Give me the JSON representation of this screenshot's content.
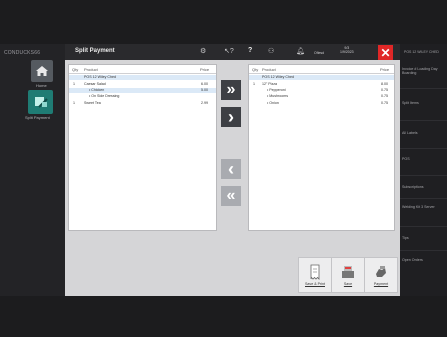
{
  "app": {
    "section_title": "CONDUCKS66",
    "window_title": "Split Payment"
  },
  "sidebar": {
    "items": [
      {
        "label": "Home",
        "icon": "house-icon"
      },
      {
        "label": "Split Payment",
        "icon": "split-payment-icon"
      }
    ]
  },
  "header": {
    "date_line1": "9/3",
    "date_line2": "1/9/2023",
    "status_label": "Ofiesd",
    "close_icon": "close-icon"
  },
  "left_list": {
    "col_qty": "Qty",
    "col_product": "Product",
    "col_price": "Price",
    "rows": [
      {
        "qty": "",
        "product": "POS 12 Wiley Ched",
        "price": "",
        "selected": true
      },
      {
        "qty": "1",
        "product": "Caesar Salad",
        "price": "6.00",
        "selected": false
      },
      {
        "qty": "",
        "product": "• Chicken",
        "price": "5.00",
        "selected": true
      },
      {
        "qty": "",
        "product": "• On Side Dressing",
        "price": "",
        "selected": false
      },
      {
        "qty": "1",
        "product": "Sweet Tea",
        "price": "2.99",
        "selected": false
      }
    ]
  },
  "right_list": {
    "col_qty": "Qty",
    "col_product": "Product",
    "col_price": "Price",
    "rows": [
      {
        "qty": "",
        "product": "POS 12 Wiley Ched",
        "price": "",
        "selected": true
      },
      {
        "qty": "1",
        "product": "12\" Pizza",
        "price": "8.00",
        "selected": false
      },
      {
        "qty": "",
        "product": "• Pepperoni",
        "price": "0.75",
        "selected": false
      },
      {
        "qty": "",
        "product": "• Mushrooms",
        "price": "0.75",
        "selected": false
      },
      {
        "qty": "",
        "product": "• Onion",
        "price": "0.75",
        "selected": false
      }
    ]
  },
  "arrows": {
    "move_all_right": "»",
    "move_right": "›",
    "move_left": "‹",
    "move_all_left": "«"
  },
  "actions": {
    "save_print": "Save & Print",
    "save": "Save",
    "payment": "Payment"
  },
  "right_panel": {
    "top_label": "POS 12 WILEY CHED",
    "items": [
      "Invoice # Loading Day Boarding",
      "Split Items",
      "All Labels",
      "POS",
      "Subscriptions",
      "Welding Kit 3 Server",
      "Tips",
      "Open Orders"
    ]
  },
  "colors": {
    "accent_teal": "#1f7c74",
    "close_red": "#e02727",
    "selected_row": "#dbe9f7",
    "arrow_dark": "#3d3f44",
    "arrow_light": "#a9abb0"
  }
}
